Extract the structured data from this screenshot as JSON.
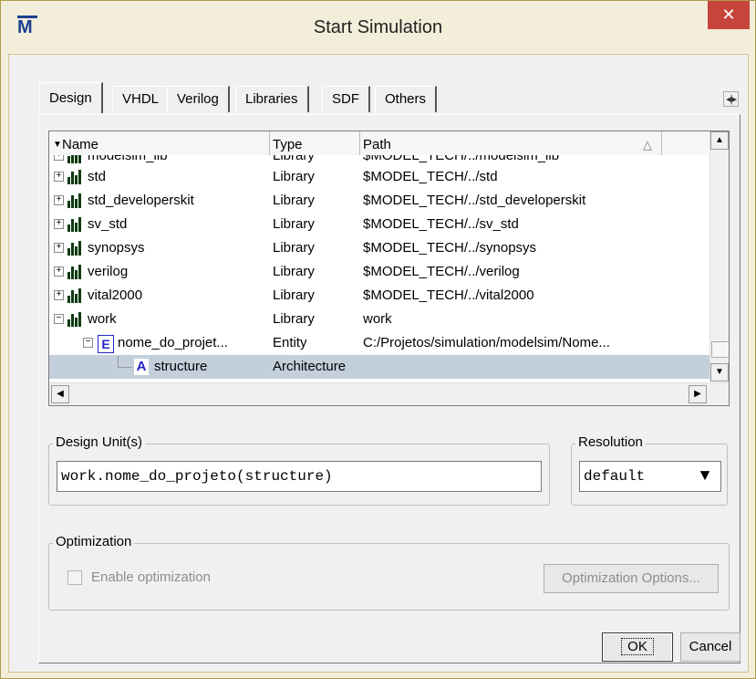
{
  "window": {
    "title": "Start Simulation",
    "app_icon": "M",
    "close_glyph": "✕"
  },
  "tabs": [
    "Design",
    "VHDL",
    "Verilog",
    "Libraries",
    "SDF",
    "Others"
  ],
  "tab_scroll": "◂|▸",
  "tree": {
    "columns": {
      "name": "Name",
      "type": "Type",
      "path": "Path",
      "sort_glyph": "△"
    },
    "rows": [
      {
        "name": "modelsim_lib",
        "type": "Library",
        "path": "$MODEL_TECH/../modelsim_lib"
      },
      {
        "name": "std",
        "type": "Library",
        "path": "$MODEL_TECH/../std"
      },
      {
        "name": "std_developerskit",
        "type": "Library",
        "path": "$MODEL_TECH/../std_developerskit"
      },
      {
        "name": "sv_std",
        "type": "Library",
        "path": "$MODEL_TECH/../sv_std"
      },
      {
        "name": "synopsys",
        "type": "Library",
        "path": "$MODEL_TECH/../synopsys"
      },
      {
        "name": "verilog",
        "type": "Library",
        "path": "$MODEL_TECH/../verilog"
      },
      {
        "name": "vital2000",
        "type": "Library",
        "path": "$MODEL_TECH/../vital2000"
      },
      {
        "name": "work",
        "type": "Library",
        "path": "work"
      },
      {
        "name": "nome_do_projet...",
        "type": "Entity",
        "path": "C:/Projetos/simulation/modelsim/Nome..."
      },
      {
        "name": "structure",
        "type": "Architecture",
        "path": ""
      }
    ]
  },
  "design_unit": {
    "label": "Design Unit(s)",
    "value": "work.nome_do_projeto(structure)"
  },
  "resolution": {
    "label": "Resolution",
    "value": "default",
    "arrow": "▼"
  },
  "optimization": {
    "label": "Optimization",
    "enable_label": "Enable optimization",
    "options_button": "Optimization Options..."
  },
  "buttons": {
    "ok": "OK",
    "cancel": "Cancel"
  },
  "colors": {
    "selection": "#c3d0dc",
    "close": "#c7443a",
    "icon_blue": "#2525c8",
    "chrome": "#f2eeda"
  }
}
